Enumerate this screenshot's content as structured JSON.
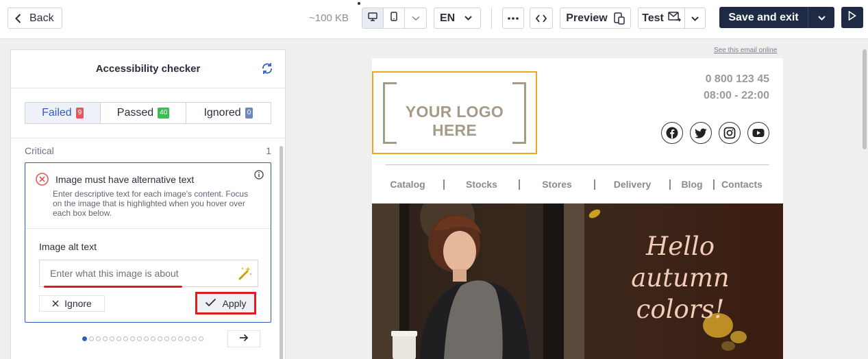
{
  "topbar": {
    "back_label": "Back",
    "size": "~100 KB",
    "language": "EN",
    "preview_label": "Preview",
    "test_label": "Test",
    "save_label": "Save and exit"
  },
  "panel": {
    "title": "Accessibility checker",
    "tabs": [
      {
        "label": "Failed",
        "count": "9",
        "color": "#e5575b"
      },
      {
        "label": "Passed",
        "count": "40",
        "color": "#3dbb56"
      },
      {
        "label": "Ignored",
        "count": "0",
        "color": "#6c87b7"
      }
    ],
    "section_label": "Critical",
    "section_count": "1",
    "issue": {
      "title": "Image must have alternative text",
      "description": "Enter descriptive text for each image's content. Focus on the image that is highlighted when you hover over each box below.",
      "field_label": "Image alt text",
      "placeholder": "Enter what this image is about",
      "ignore_label": "Ignore",
      "apply_label": "Apply"
    },
    "pager": {
      "total": 18,
      "current": 1
    }
  },
  "email": {
    "see_online": "See this email online",
    "logo_text": "YOUR LOGO HERE",
    "phone": "0 800 123 45",
    "hours": "08:00 - 22:00",
    "social": [
      "facebook-icon",
      "twitter-icon",
      "instagram-icon",
      "youtube-icon"
    ],
    "nav": [
      "Catalog",
      "Stocks",
      "Stores",
      "Delivery",
      "Blog",
      "Contacts"
    ],
    "hero_line1": "Hello",
    "hero_line2": "autumn",
    "hero_line3": "colors!"
  },
  "colors": {
    "accent": "#2f5cbf",
    "primary_dark": "#1f2a44",
    "highlight": "#e4191e",
    "logo_border": "#f3a51b"
  }
}
